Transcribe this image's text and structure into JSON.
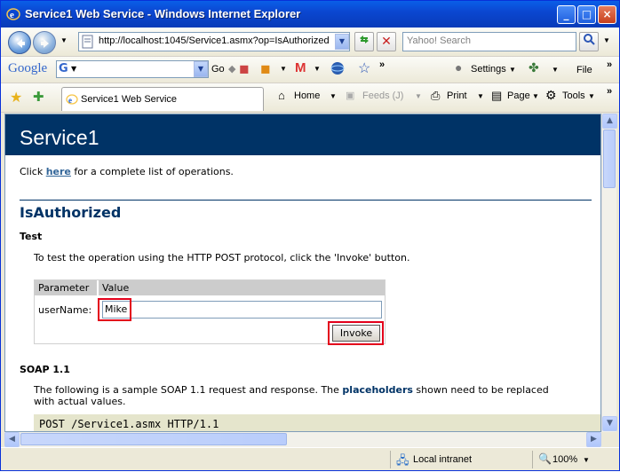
{
  "window": {
    "title": "Service1 Web Service - Windows Internet Explorer"
  },
  "address": {
    "url": "http://localhost:1045/Service1.asmx?op=IsAuthorized"
  },
  "search": {
    "placeholder": "Yahoo! Search"
  },
  "google_bar": {
    "brand": "Google",
    "go_label": "Go",
    "settings_label": "Settings",
    "file_label": "File"
  },
  "tabs": [
    {
      "label": "Service1 Web Service"
    }
  ],
  "command_bar": {
    "home": "Home",
    "feeds": "Feeds (J)",
    "print": "Print",
    "page": "Page",
    "tools": "Tools"
  },
  "page": {
    "header_title": "Service1",
    "intro_prefix": "Click ",
    "intro_link": "here",
    "intro_suffix": " for a complete list of operations.",
    "operation_title": "IsAuthorized",
    "test_heading": "Test",
    "test_instructions": "To test the operation using the HTTP POST protocol, click the 'Invoke' button.",
    "table_headers": [
      "Parameter",
      "Value"
    ],
    "param_label": "userName:",
    "param_value": "Mike",
    "invoke_label": "Invoke",
    "soap_heading": "SOAP 1.1",
    "soap_text_prefix": "The following is a sample SOAP 1.1 request and response. The ",
    "soap_text_link": "placeholders",
    "soap_text_suffix": " shown need to be replaced",
    "soap_text_line2": "with actual values.",
    "code_line": "POST /Service1.asmx HTTP/1.1"
  },
  "statusbar": {
    "zone": "Local intranet",
    "zoom": "100%"
  },
  "colors": {
    "header_bg": "#003366",
    "link": "#336699",
    "highlight_box": "#e3001b",
    "code_bg": "#e5e5cc"
  }
}
